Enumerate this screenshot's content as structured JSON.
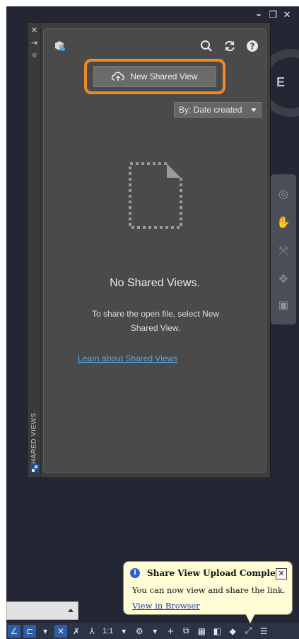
{
  "window": {
    "controls": [
      "–",
      "❐",
      "✕"
    ]
  },
  "viewcube": {
    "label": "E"
  },
  "palette": {
    "vertical_title": "SHARED VIEWS",
    "strip_controls": [
      "✕",
      "⇥",
      "☼"
    ]
  },
  "panel": {
    "toolbar_icons": [
      "logo-icon",
      "search-icon",
      "refresh-icon",
      "help-icon"
    ],
    "new_shared_view_label": "New Shared View",
    "sort": {
      "selected": "By: Date created"
    },
    "empty_title": "No Shared Views.",
    "empty_desc": "To share the open file, select New Shared View.",
    "learn_link": "Learn about Shared Views"
  },
  "notification": {
    "title": "Share View Upload Complete",
    "close_label": "✕",
    "message": "You can now view and share the link.",
    "link": "View in Browser"
  },
  "statusbar": {
    "scale_text": "1:1"
  },
  "colors": {
    "highlight": "#f08a24",
    "link": "#5aa7e3",
    "balloon_bg": "#fffcd6"
  }
}
